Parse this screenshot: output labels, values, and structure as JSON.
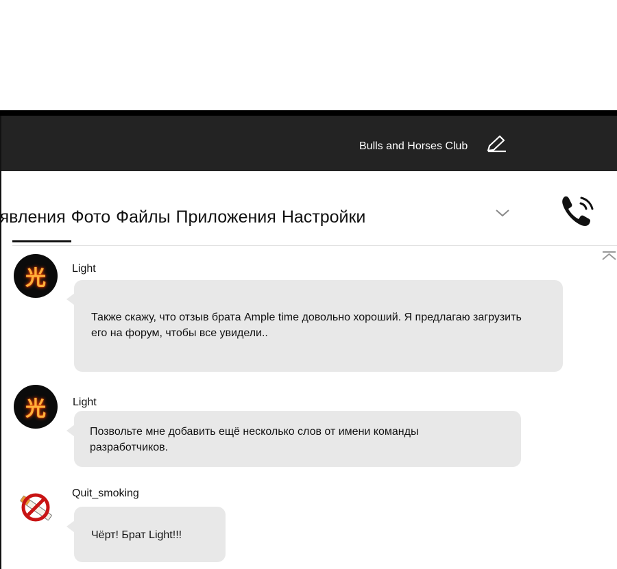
{
  "header": {
    "title": "Bulls and Horses Club",
    "edit_icon": "edit-pencil-icon"
  },
  "tabs": {
    "items": [
      "ъявления",
      "Фото",
      "Файлы",
      "Приложения",
      "Настройки"
    ],
    "active_index": 0,
    "more_icon": "chevron-down-icon",
    "call_icon": "phone-call-icon",
    "collapse_icon": "collapse-up-icon"
  },
  "messages": [
    {
      "user": "Light",
      "avatar": "light-kanji-avatar",
      "text": "Также скажу, что отзыв брата Ample time довольно хороший. Я предлагаю загрузить его на форум, чтобы все увидели.."
    },
    {
      "user": "Light",
      "avatar": "light-kanji-avatar",
      "text": "Позвольте мне добавить ещё несколько слов от имени команды разработчиков."
    },
    {
      "user": "Quit_smoking",
      "avatar": "no-smoking-avatar",
      "text": "Чёрт! Брат Light!!!"
    }
  ],
  "colors": {
    "header_bg": "#232323",
    "bubble_bg": "#e8e8e8",
    "avatar_glyph": "#ffb13a"
  }
}
